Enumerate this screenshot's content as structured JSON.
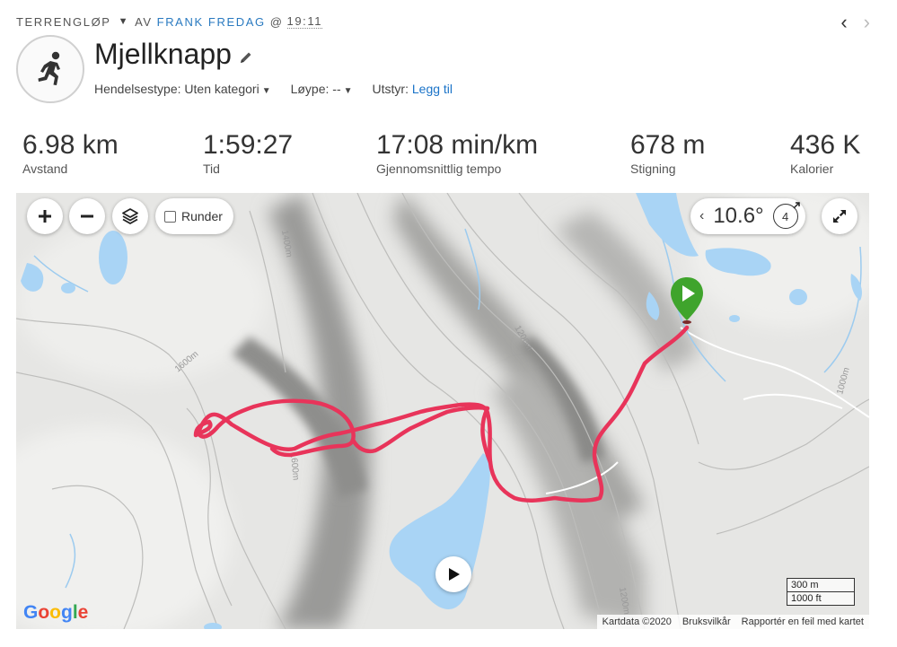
{
  "header": {
    "activity_type": "TERRENGLØP",
    "by_text": "AV",
    "author": "FRANK FREDAG",
    "at_symbol": "@",
    "time": "19:11",
    "title": "Mjellknapp"
  },
  "meta": {
    "event_type_label": "Hendelsestype:",
    "event_type_value": "Uten kategori",
    "course_label": "Løype:",
    "course_value": "--",
    "gear_label": "Utstyr:",
    "gear_value": "Legg til"
  },
  "stats": [
    {
      "value": "6.98 km",
      "label": "Avstand"
    },
    {
      "value": "1:59:27",
      "label": "Tid"
    },
    {
      "value": "17:08 min/km",
      "label": "Gjennomsnittlig tempo"
    },
    {
      "value": "678 m",
      "label": "Stigning"
    },
    {
      "value": "436 K",
      "label": "Kalorier"
    }
  ],
  "map": {
    "laps_label": "Runder",
    "temperature": "10.6°",
    "wind_speed": "4",
    "scale_metric": "300 m",
    "scale_imperial": "1000 ft",
    "attribution": [
      "Kartdata ©2020",
      "Bruksvilkår",
      "Rapportér en feil med kartet"
    ],
    "google_logo": "Google",
    "contour_labels": [
      "1400m",
      "1600m",
      "1200m",
      "1600m",
      "1000m",
      "1200m"
    ],
    "track_color": "#e8345a",
    "start_marker_color": "#3fa42c",
    "water_color": "#a9d4f5"
  },
  "icons": {
    "activity": "runner-icon",
    "edit": "pencil-icon",
    "zoom_in": "plus-icon",
    "zoom_out": "minus-icon",
    "layers": "layers-icon",
    "fullscreen": "expand-icon",
    "play": "play-icon"
  }
}
